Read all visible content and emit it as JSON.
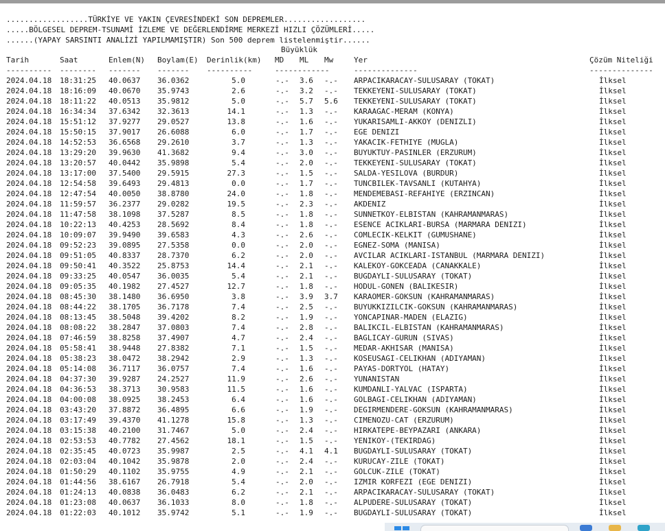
{
  "header": {
    "line1": "..................TÜRKİYE VE YAKIN ÇEVRESİNDEKİ SON DEPREMLER..................",
    "line2": ".....BÖLGESEL DEPREM-TSUNAMİ İZLEME VE DEĞERLENDİRME MERKEZİ HIZLI ÇÖZÜMLERİ.....",
    "line3": "......(YAPAY SARSINTI ANALİZİ YAPILMAMIŞTIR) Son 500 deprem listelenmiştir......",
    "magnitude_group": "Büyüklük"
  },
  "columns": {
    "date": "Tarih",
    "time": "Saat",
    "lat": "Enlem(N)",
    "lon": "Boylam(E)",
    "depth": "Derinlik(km)",
    "md": "MD",
    "ml": "ML",
    "mw": "Mw",
    "place": "Yer",
    "quality": "Çözüm Niteliği"
  },
  "separators": {
    "date": "----------",
    "time": "--------",
    "lat": "-------",
    "lon": "-------",
    "depth": "----------",
    "mag": "------------",
    "place": "--------------",
    "quality": "--------------"
  },
  "rows": [
    {
      "date": "2024.04.18",
      "time": "18:31:25",
      "lat": "40.0637",
      "lon": "36.0362",
      "depth": "5.0",
      "md": "-.-",
      "ml": "3.6",
      "mw": "-.-",
      "place": "ARPACIKARACAY-SULUSARAY (TOKAT)",
      "quality": "İlksel"
    },
    {
      "date": "2024.04.18",
      "time": "18:16:09",
      "lat": "40.0670",
      "lon": "35.9743",
      "depth": "2.6",
      "md": "-.-",
      "ml": "3.2",
      "mw": "-.-",
      "place": "TEKKEYENI-SULUSARAY (TOKAT)",
      "quality": "İlksel"
    },
    {
      "date": "2024.04.18",
      "time": "18:11:22",
      "lat": "40.0513",
      "lon": "35.9812",
      "depth": "5.0",
      "md": "-.-",
      "ml": "5.7",
      "mw": "5.6",
      "place": "TEKKEYENI-SULUSARAY (TOKAT)",
      "quality": "İlksel"
    },
    {
      "date": "2024.04.18",
      "time": "16:34:34",
      "lat": "37.6342",
      "lon": "32.3613",
      "depth": "14.1",
      "md": "-.-",
      "ml": "1.3",
      "mw": "-.-",
      "place": "KARAAGAC-MERAM (KONYA)",
      "quality": "İlksel"
    },
    {
      "date": "2024.04.18",
      "time": "15:51:12",
      "lat": "37.9277",
      "lon": "29.0527",
      "depth": "13.8",
      "md": "-.-",
      "ml": "1.6",
      "mw": "-.-",
      "place": "YUKARISAMLI-AKKOY (DENIZLI)",
      "quality": "İlksel"
    },
    {
      "date": "2024.04.18",
      "time": "15:50:15",
      "lat": "37.9017",
      "lon": "26.6088",
      "depth": "6.0",
      "md": "-.-",
      "ml": "1.7",
      "mw": "-.-",
      "place": "EGE DENIZI",
      "quality": "İlksel"
    },
    {
      "date": "2024.04.18",
      "time": "14:52:53",
      "lat": "36.6568",
      "lon": "29.2610",
      "depth": "3.7",
      "md": "-.-",
      "ml": "1.3",
      "mw": "-.-",
      "place": "YAKACIK-FETHIYE (MUGLA)",
      "quality": "İlksel"
    },
    {
      "date": "2024.04.18",
      "time": "13:29:20",
      "lat": "39.9630",
      "lon": "41.3682",
      "depth": "9.4",
      "md": "-.-",
      "ml": "3.0",
      "mw": "-.-",
      "place": "BUYUKTUY-PASINLER (ERZURUM)",
      "quality": "İlksel"
    },
    {
      "date": "2024.04.18",
      "time": "13:20:57",
      "lat": "40.0442",
      "lon": "35.9898",
      "depth": "5.4",
      "md": "-.-",
      "ml": "2.0",
      "mw": "-.-",
      "place": "TEKKEYENI-SULUSARAY (TOKAT)",
      "quality": "İlksel"
    },
    {
      "date": "2024.04.18",
      "time": "13:17:00",
      "lat": "37.5400",
      "lon": "29.5915",
      "depth": "27.3",
      "md": "-.-",
      "ml": "1.5",
      "mw": "-.-",
      "place": "SALDA-YESILOVA (BURDUR)",
      "quality": "İlksel"
    },
    {
      "date": "2024.04.18",
      "time": "12:54:58",
      "lat": "39.6493",
      "lon": "29.4813",
      "depth": "0.0",
      "md": "-.-",
      "ml": "1.7",
      "mw": "-.-",
      "place": "TUNCBILEK-TAVSANLI (KUTAHYA)",
      "quality": "İlksel"
    },
    {
      "date": "2024.04.18",
      "time": "12:47:54",
      "lat": "40.0050",
      "lon": "38.8780",
      "depth": "24.0",
      "md": "-.-",
      "ml": "1.8",
      "mw": "-.-",
      "place": "MENDEMEBASI-REFAHIYE (ERZINCAN)",
      "quality": "İlksel"
    },
    {
      "date": "2024.04.18",
      "time": "11:59:57",
      "lat": "36.2377",
      "lon": "29.0282",
      "depth": "19.5",
      "md": "-.-",
      "ml": "2.3",
      "mw": "-.-",
      "place": "AKDENIZ",
      "quality": "İlksel"
    },
    {
      "date": "2024.04.18",
      "time": "11:47:58",
      "lat": "38.1098",
      "lon": "37.5287",
      "depth": "8.5",
      "md": "-.-",
      "ml": "1.8",
      "mw": "-.-",
      "place": "SUNNETKOY-ELBISTAN (KAHRAMANMARAS)",
      "quality": "İlksel"
    },
    {
      "date": "2024.04.18",
      "time": "10:22:13",
      "lat": "40.4253",
      "lon": "28.5692",
      "depth": "8.4",
      "md": "-.-",
      "ml": "1.8",
      "mw": "-.-",
      "place": "ESENCE ACIKLARI-BURSA (MARMARA DENIZI)",
      "quality": "İlksel"
    },
    {
      "date": "2024.04.18",
      "time": "10:09:07",
      "lat": "39.9490",
      "lon": "39.6583",
      "depth": "4.3",
      "md": "-.-",
      "ml": "2.6",
      "mw": "-.-",
      "place": "COMLECIK-KELKIT (GUMUSHANE)",
      "quality": "İlksel"
    },
    {
      "date": "2024.04.18",
      "time": "09:52:23",
      "lat": "39.0895",
      "lon": "27.5358",
      "depth": "0.0",
      "md": "-.-",
      "ml": "2.0",
      "mw": "-.-",
      "place": "EGNEZ-SOMA (MANISA)",
      "quality": "İlksel"
    },
    {
      "date": "2024.04.18",
      "time": "09:51:05",
      "lat": "40.8337",
      "lon": "28.7370",
      "depth": "6.2",
      "md": "-.-",
      "ml": "2.0",
      "mw": "-.-",
      "place": "AVCILAR ACIKLARI-ISTANBUL (MARMARA DENIZI)",
      "quality": "İlksel"
    },
    {
      "date": "2024.04.18",
      "time": "09:50:41",
      "lat": "40.3522",
      "lon": "25.8753",
      "depth": "14.4",
      "md": "-.-",
      "ml": "2.1",
      "mw": "-.-",
      "place": "KALEKOY-GOKCEADA (CANAKKALE)",
      "quality": "İlksel"
    },
    {
      "date": "2024.04.18",
      "time": "09:33:25",
      "lat": "40.0547",
      "lon": "36.0035",
      "depth": "5.4",
      "md": "-.-",
      "ml": "2.1",
      "mw": "-.-",
      "place": "BUGDAYLI-SULUSARAY (TOKAT)",
      "quality": "İlksel"
    },
    {
      "date": "2024.04.18",
      "time": "09:05:35",
      "lat": "40.1982",
      "lon": "27.4527",
      "depth": "12.7",
      "md": "-.-",
      "ml": "1.8",
      "mw": "-.-",
      "place": "HODUL-GONEN (BALIKESIR)",
      "quality": "İlksel"
    },
    {
      "date": "2024.04.18",
      "time": "08:45:30",
      "lat": "38.1480",
      "lon": "36.6950",
      "depth": "3.8",
      "md": "-.-",
      "ml": "3.9",
      "mw": "3.7",
      "place": "KARAOMER-GOKSUN (KAHRAMANMARAS)",
      "quality": "İlksel"
    },
    {
      "date": "2024.04.18",
      "time": "08:44:22",
      "lat": "38.1705",
      "lon": "36.7178",
      "depth": "7.4",
      "md": "-.-",
      "ml": "2.5",
      "mw": "-.-",
      "place": "BUYUKKIZILCIK-GOKSUN (KAHRAMANMARAS)",
      "quality": "İlksel"
    },
    {
      "date": "2024.04.18",
      "time": "08:13:45",
      "lat": "38.5048",
      "lon": "39.4202",
      "depth": "8.2",
      "md": "-.-",
      "ml": "1.9",
      "mw": "-.-",
      "place": "YONCAPINAR-MADEN (ELAZIG)",
      "quality": "İlksel"
    },
    {
      "date": "2024.04.18",
      "time": "08:08:22",
      "lat": "38.2847",
      "lon": "37.0803",
      "depth": "7.4",
      "md": "-.-",
      "ml": "2.8",
      "mw": "-.-",
      "place": "BALIKCIL-ELBISTAN (KAHRAMANMARAS)",
      "quality": "İlksel"
    },
    {
      "date": "2024.04.18",
      "time": "07:46:59",
      "lat": "38.8258",
      "lon": "37.4907",
      "depth": "4.7",
      "md": "-.-",
      "ml": "2.4",
      "mw": "-.-",
      "place": "BAGLICAY-GURUN (SIVAS)",
      "quality": "İlksel"
    },
    {
      "date": "2024.04.18",
      "time": "05:58:41",
      "lat": "38.9448",
      "lon": "27.8382",
      "depth": "7.1",
      "md": "-.-",
      "ml": "1.5",
      "mw": "-.-",
      "place": "MEDAR-AKHISAR (MANISA)",
      "quality": "İlksel"
    },
    {
      "date": "2024.04.18",
      "time": "05:38:23",
      "lat": "38.0472",
      "lon": "38.2942",
      "depth": "2.9",
      "md": "-.-",
      "ml": "1.3",
      "mw": "-.-",
      "place": "KOSEUSAGI-CELIKHAN (ADIYAMAN)",
      "quality": "İlksel"
    },
    {
      "date": "2024.04.18",
      "time": "05:14:08",
      "lat": "36.7117",
      "lon": "36.0757",
      "depth": "7.4",
      "md": "-.-",
      "ml": "1.6",
      "mw": "-.-",
      "place": "PAYAS-DORTYOL (HATAY)",
      "quality": "İlksel"
    },
    {
      "date": "2024.04.18",
      "time": "04:37:30",
      "lat": "39.9287",
      "lon": "24.2527",
      "depth": "11.9",
      "md": "-.-",
      "ml": "2.6",
      "mw": "-.-",
      "place": "YUNANISTAN",
      "quality": "İlksel"
    },
    {
      "date": "2024.04.18",
      "time": "04:36:53",
      "lat": "38.3713",
      "lon": "30.9583",
      "depth": "11.5",
      "md": "-.-",
      "ml": "1.6",
      "mw": "-.-",
      "place": "KUMDANLI-YALVAC (ISPARTA)",
      "quality": "İlksel"
    },
    {
      "date": "2024.04.18",
      "time": "04:00:08",
      "lat": "38.0925",
      "lon": "38.2453",
      "depth": "6.4",
      "md": "-.-",
      "ml": "1.6",
      "mw": "-.-",
      "place": "GOLBAGI-CELIKHAN (ADIYAMAN)",
      "quality": "İlksel"
    },
    {
      "date": "2024.04.18",
      "time": "03:43:20",
      "lat": "37.8872",
      "lon": "36.4895",
      "depth": "6.6",
      "md": "-.-",
      "ml": "1.9",
      "mw": "-.-",
      "place": "DEGIRMENDERE-GOKSUN (KAHRAMANMARAS)",
      "quality": "İlksel"
    },
    {
      "date": "2024.04.18",
      "time": "03:17:49",
      "lat": "39.4370",
      "lon": "41.1278",
      "depth": "15.8",
      "md": "-.-",
      "ml": "1.3",
      "mw": "-.-",
      "place": "CIMENOZU-CAT (ERZURUM)",
      "quality": "İlksel"
    },
    {
      "date": "2024.04.18",
      "time": "03:15:38",
      "lat": "40.2100",
      "lon": "31.7467",
      "depth": "5.0",
      "md": "-.-",
      "ml": "2.4",
      "mw": "-.-",
      "place": "HIRKATEPE-BEYPAZARI (ANKARA)",
      "quality": "İlksel"
    },
    {
      "date": "2024.04.18",
      "time": "02:53:53",
      "lat": "40.7782",
      "lon": "27.4562",
      "depth": "18.1",
      "md": "-.-",
      "ml": "1.5",
      "mw": "-.-",
      "place": "YENIKOY-(TEKIRDAG)",
      "quality": "İlksel"
    },
    {
      "date": "2024.04.18",
      "time": "02:35:45",
      "lat": "40.0723",
      "lon": "35.9987",
      "depth": "2.5",
      "md": "-.-",
      "ml": "4.1",
      "mw": "4.1",
      "place": "BUGDAYLI-SULUSARAY (TOKAT)",
      "quality": "İlksel"
    },
    {
      "date": "2024.04.18",
      "time": "02:03:04",
      "lat": "40.1042",
      "lon": "35.9878",
      "depth": "2.0",
      "md": "-.-",
      "ml": "2.4",
      "mw": "-.-",
      "place": "KURUCAY-ZILE (TOKAT)",
      "quality": "İlksel"
    },
    {
      "date": "2024.04.18",
      "time": "01:50:29",
      "lat": "40.1102",
      "lon": "35.9755",
      "depth": "4.9",
      "md": "-.-",
      "ml": "2.1",
      "mw": "-.-",
      "place": "GOLCUK-ZILE (TOKAT)",
      "quality": "İlksel"
    },
    {
      "date": "2024.04.18",
      "time": "01:44:56",
      "lat": "38.6167",
      "lon": "26.7918",
      "depth": "5.4",
      "md": "-.-",
      "ml": "2.0",
      "mw": "-.-",
      "place": "IZMIR KORFEZI (EGE DENIZI)",
      "quality": "İlksel"
    },
    {
      "date": "2024.04.18",
      "time": "01:24:13",
      "lat": "40.0838",
      "lon": "36.0483",
      "depth": "6.2",
      "md": "-.-",
      "ml": "2.1",
      "mw": "-.-",
      "place": "ARPACIKARACAY-SULUSARAY (TOKAT)",
      "quality": "İlksel"
    },
    {
      "date": "2024.04.18",
      "time": "01:23:08",
      "lat": "40.0637",
      "lon": "36.1033",
      "depth": "8.0",
      "md": "-.-",
      "ml": "1.8",
      "mw": "-.-",
      "place": "ALPUDERE-SULUSARAY (TOKAT)",
      "quality": "İlksel"
    },
    {
      "date": "2024.04.18",
      "time": "01:22:03",
      "lat": "40.1012",
      "lon": "35.9742",
      "depth": "5.1",
      "md": "-.-",
      "ml": "1.9",
      "mw": "-.-",
      "place": "BUGDAYLI-SULUSARAY (TOKAT)",
      "quality": "İlksel"
    }
  ],
  "colors": {
    "text": "#1a1a1a",
    "background": "#ffffff",
    "topbar": "#9c9c9c",
    "taskbar": "#e6ecf2",
    "windows_logo": "#2b8ae6"
  },
  "taskbar": {
    "icons": [
      "windows-start-icon",
      "search-box",
      "widgets-icon",
      "file-explorer-icon",
      "store-icon"
    ]
  }
}
